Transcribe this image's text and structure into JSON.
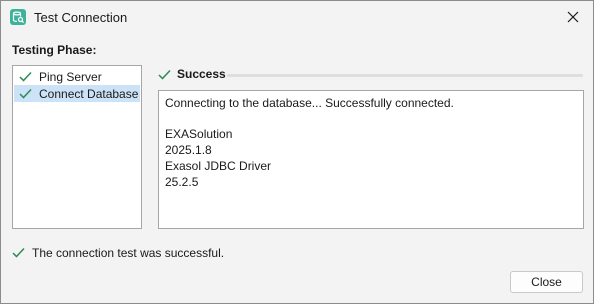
{
  "window": {
    "title": "Test Connection",
    "app_icon": "database-search-icon",
    "close_icon": "close-icon"
  },
  "phase": {
    "heading": "Testing Phase:",
    "items": [
      {
        "label": "Ping Server",
        "status": "passed",
        "icon": "check-icon",
        "selected": false
      },
      {
        "label": "Connect Database",
        "status": "passed",
        "icon": "check-icon",
        "selected": true
      }
    ]
  },
  "status": {
    "label": "Success",
    "icon": "check-icon"
  },
  "log": {
    "lines": [
      "Connecting to the database... Successfully connected.",
      "",
      "EXASolution",
      "2025.1.8",
      "Exasol JDBC Driver",
      "25.2.5"
    ]
  },
  "footer": {
    "message": "The connection test was successful.",
    "icon": "check-icon",
    "close_label": "Close"
  },
  "colors": {
    "success_green": "#2e8b57",
    "selection": "#cce3f7",
    "app_icon_bg": "#3fb39a"
  }
}
